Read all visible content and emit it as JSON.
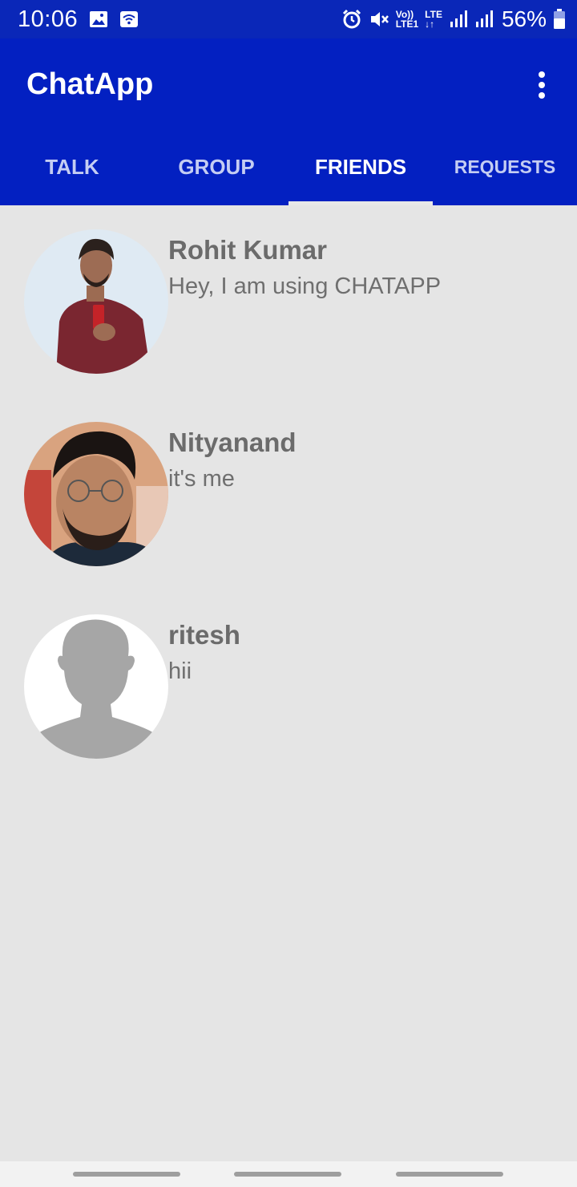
{
  "status_bar": {
    "time": "10:06",
    "lte_top": "LTE",
    "volte_top": "Vo))",
    "volte_bottom": "LTE1",
    "battery_percent": "56%"
  },
  "app_bar": {
    "title": "ChatApp"
  },
  "tabs": [
    {
      "label": "TALK",
      "active": false
    },
    {
      "label": "GROUP",
      "active": false
    },
    {
      "label": "FRIENDS",
      "active": true
    },
    {
      "label": "REQUESTS",
      "active": false
    }
  ],
  "friends": [
    {
      "name": "Rohit Kumar",
      "status": "Hey, I am using CHATAPP"
    },
    {
      "name": "Nityanand",
      "status": "it's me"
    },
    {
      "name": "ritesh",
      "status": "hii"
    }
  ],
  "colors": {
    "primary": "#0320c1",
    "status_bar": "#0a27b8",
    "background": "#e5e5e5"
  }
}
